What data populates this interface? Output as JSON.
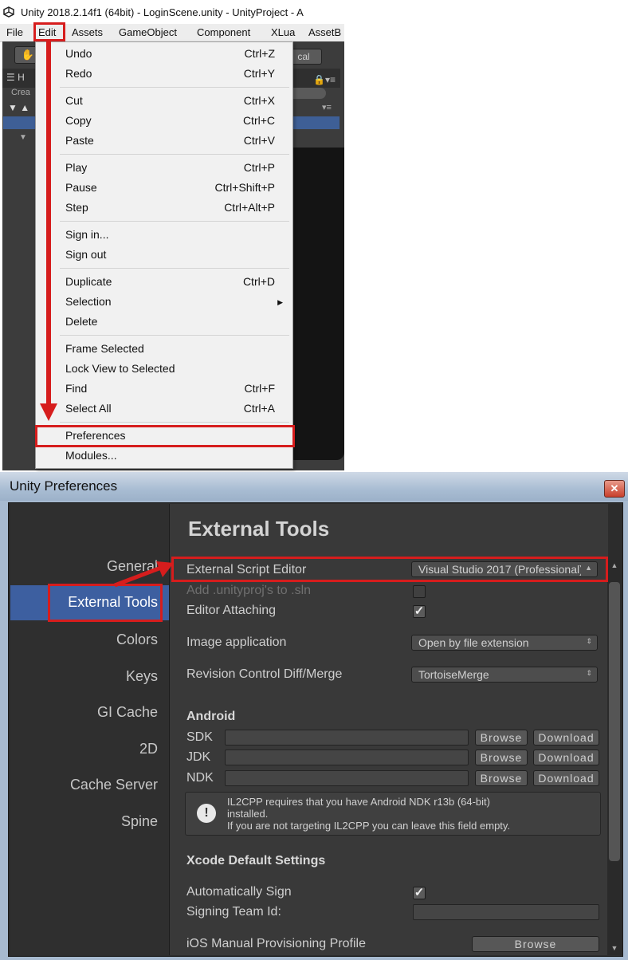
{
  "main_window": {
    "title": "Unity 2018.2.14f1 (64bit) - LoginScene.unity - UnityProject - A",
    "menubar": [
      "File",
      "Edit",
      "Assets",
      "GameObject",
      "Component",
      "XLua",
      "AssetB"
    ],
    "toolbar": {
      "local_label": "cal"
    },
    "hierarchy": {
      "tab_label": "H",
      "create_label": "Crea"
    }
  },
  "edit_menu": {
    "groups": [
      [
        {
          "label": "Undo",
          "shortcut": "Ctrl+Z"
        },
        {
          "label": "Redo",
          "shortcut": "Ctrl+Y"
        }
      ],
      [
        {
          "label": "Cut",
          "shortcut": "Ctrl+X"
        },
        {
          "label": "Copy",
          "shortcut": "Ctrl+C"
        },
        {
          "label": "Paste",
          "shortcut": "Ctrl+V"
        }
      ],
      [
        {
          "label": "Play",
          "shortcut": "Ctrl+P"
        },
        {
          "label": "Pause",
          "shortcut": "Ctrl+Shift+P"
        },
        {
          "label": "Step",
          "shortcut": "Ctrl+Alt+P"
        }
      ],
      [
        {
          "label": "Sign in...",
          "shortcut": ""
        },
        {
          "label": "Sign out",
          "shortcut": ""
        }
      ],
      [
        {
          "label": "Duplicate",
          "shortcut": "Ctrl+D"
        },
        {
          "label": "Selection",
          "shortcut": "",
          "submenu": true
        },
        {
          "label": "Delete",
          "shortcut": ""
        }
      ],
      [
        {
          "label": "Frame Selected",
          "shortcut": ""
        },
        {
          "label": "Lock View to Selected",
          "shortcut": ""
        },
        {
          "label": "Find",
          "shortcut": "Ctrl+F"
        },
        {
          "label": "Select All",
          "shortcut": "Ctrl+A"
        }
      ],
      [
        {
          "label": "Preferences",
          "shortcut": ""
        },
        {
          "label": "Modules...",
          "shortcut": ""
        }
      ]
    ]
  },
  "preferences": {
    "window_title": "Unity Preferences",
    "sidebar": [
      "General",
      "External Tools",
      "Colors",
      "Keys",
      "GI Cache",
      "2D",
      "Cache Server",
      "Spine"
    ],
    "selected_sidebar": "External Tools",
    "heading": "External Tools",
    "external_script_editor": {
      "label": "External Script Editor",
      "value": "Visual Studio 2017 (Professional)"
    },
    "add_unityproj": {
      "label": "Add .unityproj's to .sln",
      "checked": false,
      "disabled": true
    },
    "editor_attaching": {
      "label": "Editor Attaching",
      "checked": true
    },
    "image_application": {
      "label": "Image application",
      "value": "Open by file extension"
    },
    "revision_control": {
      "label": "Revision Control Diff/Merge",
      "value": "TortoiseMerge"
    },
    "android": {
      "title": "Android",
      "rows": [
        {
          "label": "SDK",
          "browse": "Browse",
          "download": "Download"
        },
        {
          "label": "JDK",
          "browse": "Browse",
          "download": "Download"
        },
        {
          "label": "NDK",
          "browse": "Browse",
          "download": "Download"
        }
      ],
      "help_icon": "!",
      "help_lines": [
        "IL2CPP requires that you have Android NDK r13b (64-bit)",
        "installed.",
        "If you are not targeting IL2CPP you can leave this field empty."
      ]
    },
    "xcode": {
      "title": "Xcode Default Settings",
      "auto_sign": {
        "label": "Automatically Sign",
        "checked": true
      },
      "signing_team": {
        "label": "Signing Team Id:",
        "value": ""
      },
      "ios_profile": {
        "label": "iOS Manual Provisioning Profile",
        "browse": "Browse"
      }
    }
  },
  "annotation_color": "#d61d1d"
}
